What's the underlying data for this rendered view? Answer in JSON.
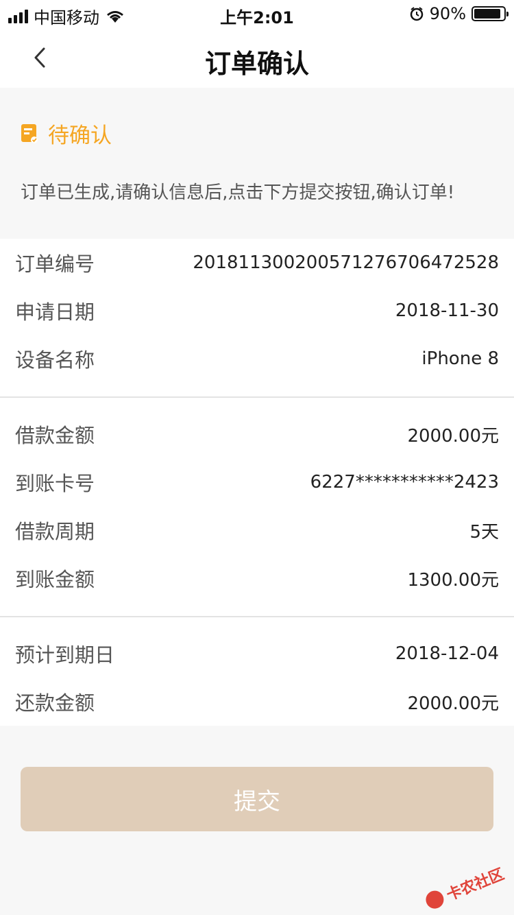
{
  "status_bar": {
    "carrier": "中国移动",
    "time": "上午2:01",
    "battery_percent": "90%",
    "signal_bars": 4,
    "battery_level": 0.9
  },
  "nav": {
    "title": "订单确认",
    "back_icon": "chevron-left-icon"
  },
  "notice": {
    "status": "待确认",
    "status_color": "#f5a623",
    "icon": "document-check-icon",
    "message": "订单已生成,请确认信息后,点击下方提交按钮,确认订单!"
  },
  "order": {
    "rows": [
      {
        "label": "订单编号",
        "value": "201811300200571276706472528"
      },
      {
        "label": "申请日期",
        "value": "2018-11-30"
      },
      {
        "label": "设备名称",
        "value": "iPhone 8"
      }
    ]
  },
  "loan": {
    "rows": [
      {
        "label": "借款金额",
        "value": "2000.00元"
      },
      {
        "label": "到账卡号",
        "value": "6227***********2423"
      },
      {
        "label": "借款周期",
        "value": "5天"
      },
      {
        "label": "到账金额",
        "value": "1300.00元"
      }
    ]
  },
  "repay": {
    "rows": [
      {
        "label": "预计到期日",
        "value": "2018-12-04"
      },
      {
        "label": "还款金额",
        "value": "2000.00元"
      }
    ]
  },
  "submit": {
    "label": "提交",
    "color": "#e0cdb8"
  },
  "watermark": {
    "text": "卡农社区"
  }
}
